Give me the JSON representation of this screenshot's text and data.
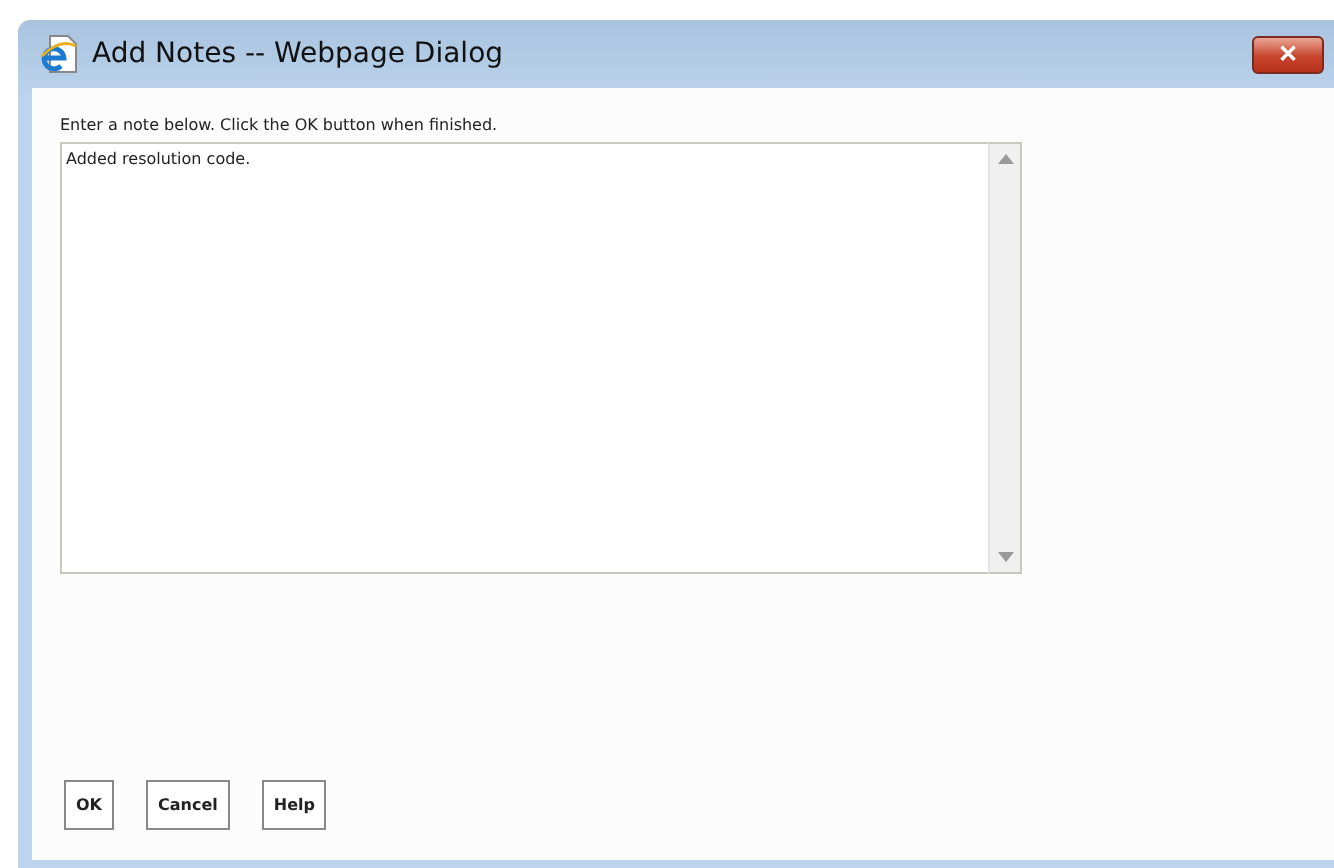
{
  "window": {
    "title": "Add Notes -- Webpage Dialog",
    "close_icon": "✕"
  },
  "instruction": "Enter a note below. Click the OK button when finished.",
  "note": {
    "value": "Added resolution code."
  },
  "buttons": [
    "OK",
    "Cancel",
    "Help"
  ]
}
